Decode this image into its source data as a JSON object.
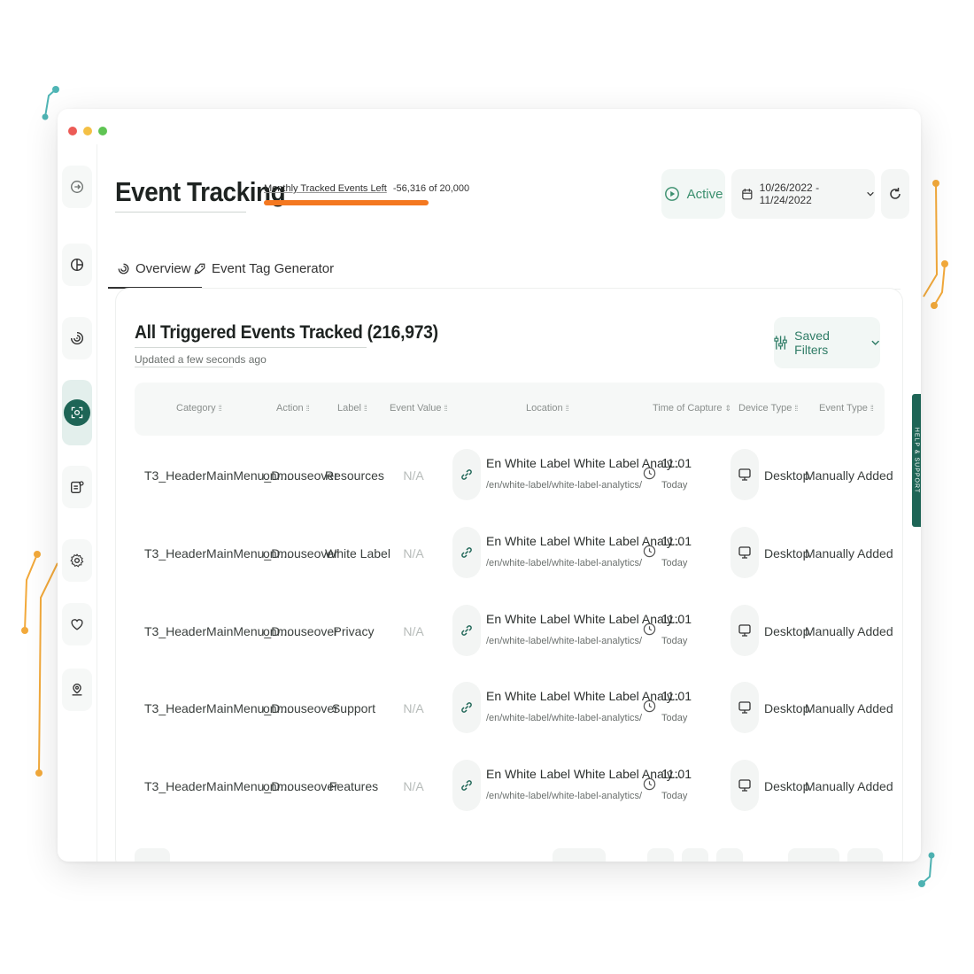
{
  "colors": {
    "brand": "#1e6556",
    "accent_orange": "#f47820",
    "active_green": "#3b8f6e",
    "teal_deco": "#4fb5b5",
    "window_dot_red": "#ec5b56",
    "window_dot_yellow": "#f4c045",
    "window_dot_green": "#5fc453"
  },
  "sidebar": {
    "items": [
      {
        "icon": "sign-in-icon"
      },
      {
        "icon": "pie-chart-icon"
      },
      {
        "icon": "tracking-icon"
      },
      {
        "icon": "event-tracking-icon",
        "active": true
      },
      {
        "icon": "dashboard-settings-icon"
      },
      {
        "icon": "gear-icon"
      },
      {
        "icon": "heart-icon"
      },
      {
        "icon": "location-pin-icon"
      }
    ]
  },
  "header": {
    "title": "Event Tracking",
    "quota_label": "Monthly Tracked Events Left",
    "quota_value": "-56,316 of 20,000",
    "quota_used_fraction": 1.0,
    "status_button": "Active",
    "date_range": "10/26/2022 - 11/24/2022"
  },
  "tabs": [
    {
      "label": "Overview",
      "icon": "tracking-icon",
      "selected": true
    },
    {
      "label": "Event Tag Generator",
      "icon": "tag-icon",
      "selected": false
    }
  ],
  "panel": {
    "title": "All Triggered Events Tracked (216,973)",
    "subtitle": "Updated a few seconds ago",
    "filters_button": "Saved Filters"
  },
  "table": {
    "columns": [
      "Category",
      "Action",
      "Label",
      "Event Value",
      "Location",
      "Time of Capture",
      "Device Type",
      "Event Type"
    ],
    "rows": [
      {
        "category": "T3_HeaderMainMenu_D...",
        "action": "onmouseover",
        "label": "Resources",
        "event_value": "N/A",
        "location_title": "En White Label White Label Analy...",
        "location_path": "/en/white-label/white-label-analytics/",
        "time": "11:01",
        "day": "Today",
        "device": "Desktop",
        "event_type": "Manually Added"
      },
      {
        "category": "T3_HeaderMainMenu_D...",
        "action": "onmouseover",
        "label": "White Label",
        "event_value": "N/A",
        "location_title": "En White Label White Label Analy...",
        "location_path": "/en/white-label/white-label-analytics/",
        "time": "11:01",
        "day": "Today",
        "device": "Desktop",
        "event_type": "Manually Added"
      },
      {
        "category": "T3_HeaderMainMenu_D...",
        "action": "onmouseover",
        "label": "Privacy",
        "event_value": "N/A",
        "location_title": "En White Label White Label Analy...",
        "location_path": "/en/white-label/white-label-analytics/",
        "time": "11:01",
        "day": "Today",
        "device": "Desktop",
        "event_type": "Manually Added"
      },
      {
        "category": "T3_HeaderMainMenu_D...",
        "action": "onmouseover",
        "label": "Support",
        "event_value": "N/A",
        "location_title": "En White Label White Label Analy...",
        "location_path": "/en/white-label/white-label-analytics/",
        "time": "11:01",
        "day": "Today",
        "device": "Desktop",
        "event_type": "Manually Added"
      },
      {
        "category": "T3_HeaderMainMenu_D...",
        "action": "onmouseover",
        "label": "Features",
        "event_value": "N/A",
        "location_title": "En White Label White Label Analy...",
        "location_path": "/en/white-label/white-label-analytics/",
        "time": "11:01",
        "day": "Today",
        "device": "Desktop",
        "event_type": "Manually Added"
      }
    ]
  },
  "help_tab": "HELP & SUPPORT"
}
